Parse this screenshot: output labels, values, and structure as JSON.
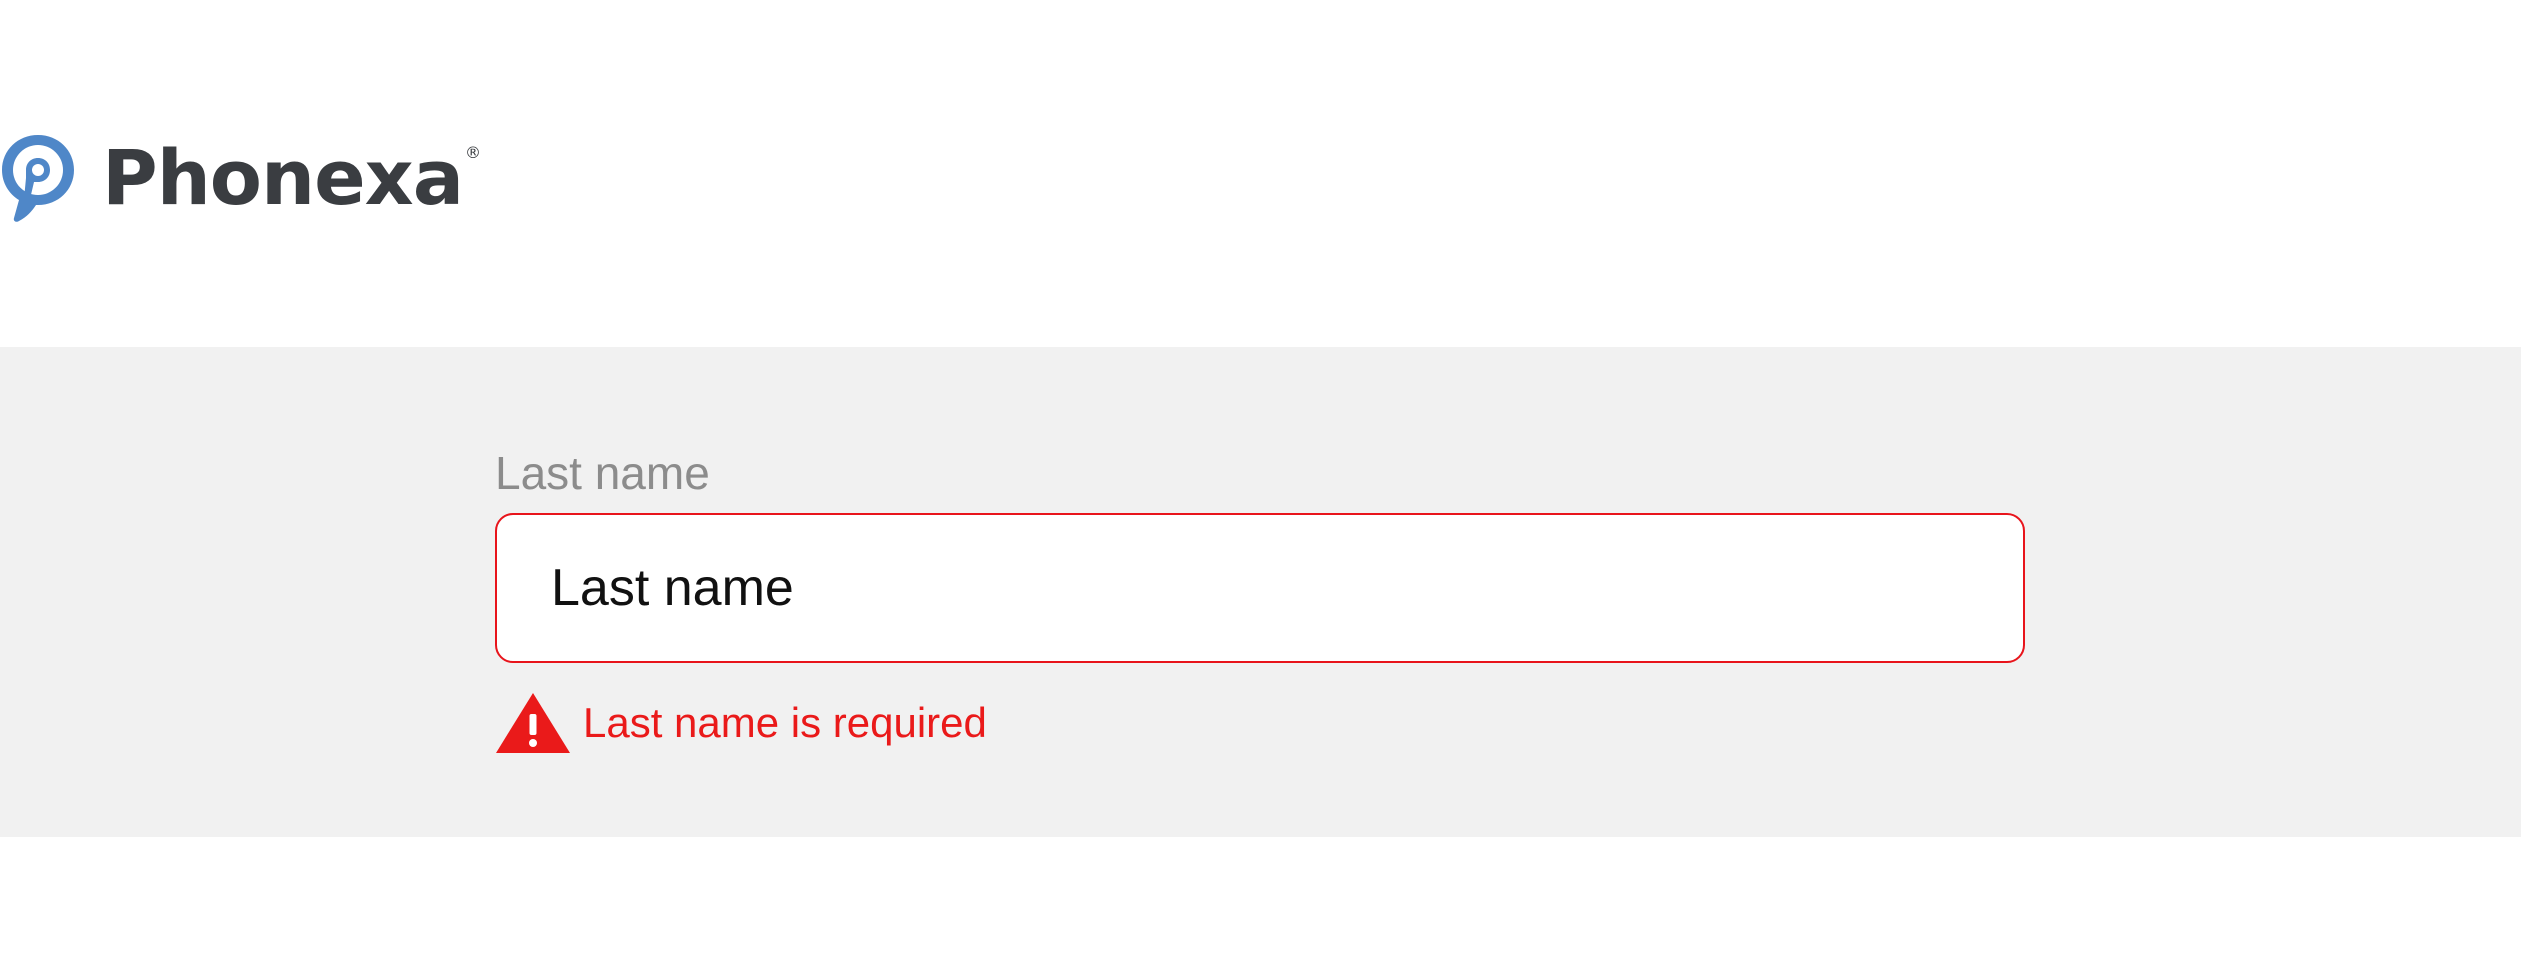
{
  "brand": {
    "name": "Phonexa",
    "registered_mark": "®",
    "logo_icon": "chat-bubble-p-icon",
    "colors": {
      "logo_blue": "#4f87c8",
      "logo_text": "#3a3d41"
    }
  },
  "form": {
    "last_name": {
      "label": "Last name",
      "placeholder": "Last name",
      "value": "",
      "error": "Last name is required",
      "error_icon": "warning-triangle-icon"
    },
    "colors": {
      "panel_background": "#f1f1f1",
      "error_red": "#e8141b",
      "label_gray": "#8c8c8c"
    }
  }
}
